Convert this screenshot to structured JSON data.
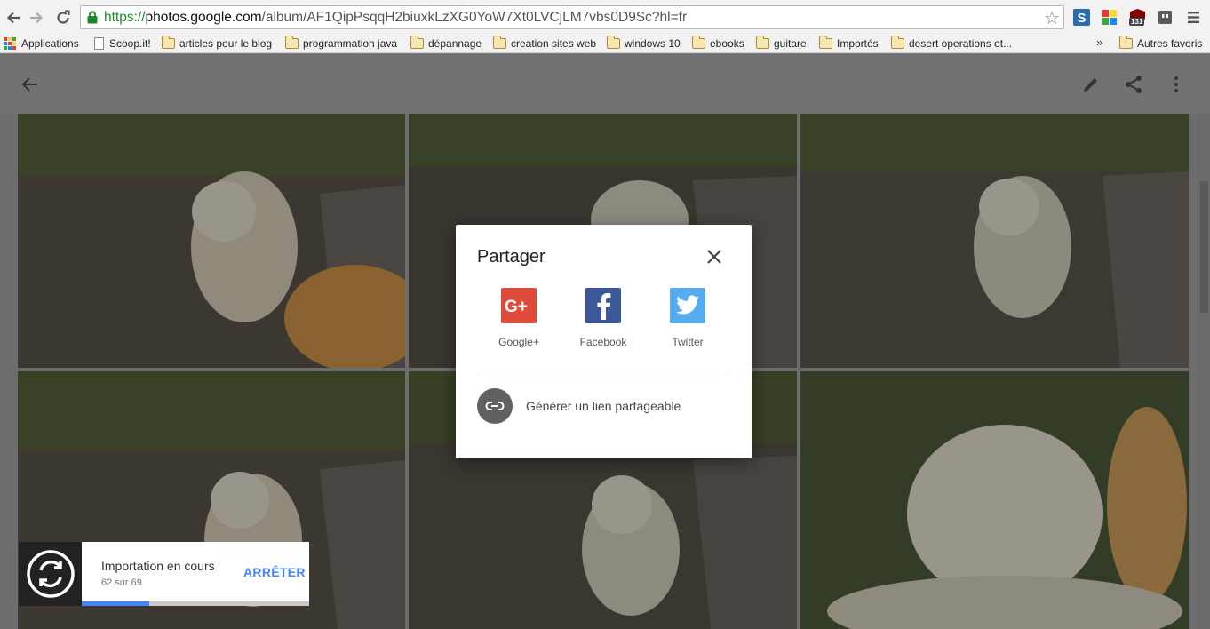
{
  "browser": {
    "url_scheme": "https://",
    "url_host": "photos.google.com",
    "url_path": "/album/AF1QipPsqqH2biuxkLzXG0YoW7Xt0LVCjLM7vbs0D9Sc?hl=fr",
    "extensions": [
      "s-extension-icon",
      "palette-extension-icon",
      "ublock-extension-icon",
      "ghost-extension-icon"
    ],
    "ublock_badge": "131"
  },
  "bookmarks": {
    "apps": "Applications",
    "items": [
      "Scoop.it!",
      "articles pour le blog",
      "programmation java",
      "dépannage",
      "creation sites web",
      "windows 10",
      "ebooks",
      "guitare",
      "Importés",
      "desert operations et..."
    ],
    "overflow": "»",
    "other": "Autres favoris"
  },
  "dialog": {
    "title": "Partager",
    "options": [
      {
        "label": "Google+",
        "color": "#dd4b39"
      },
      {
        "label": "Facebook",
        "color": "#3b5998"
      },
      {
        "label": "Twitter",
        "color": "#55acee"
      }
    ],
    "link_label": "Générer un lien partageable"
  },
  "upload": {
    "title": "Importation en cours",
    "count": "62 sur 69",
    "done": 62,
    "total": 69,
    "stop_label": "ARRÊTER",
    "accent": "#4285f4"
  }
}
